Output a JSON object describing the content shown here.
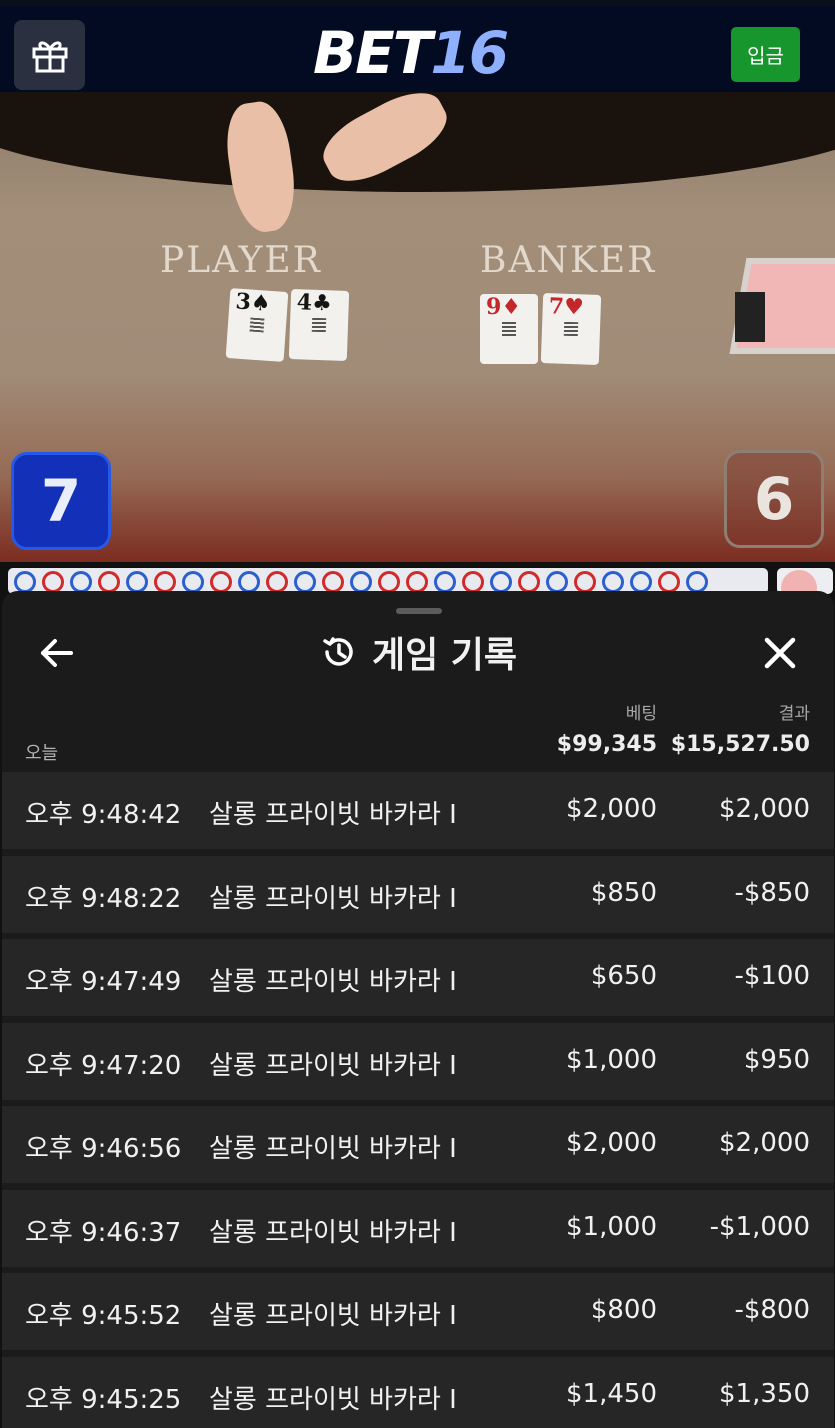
{
  "header": {
    "logo_part1": "BET",
    "logo_part2": "16",
    "deposit_label": "입금"
  },
  "game": {
    "player_label": "PLAYER",
    "banker_label": "BANKER",
    "player_cards": [
      {
        "rank": "3",
        "suit": "♠",
        "color": "black"
      },
      {
        "rank": "4",
        "suit": "♣",
        "color": "black"
      }
    ],
    "banker_cards": [
      {
        "rank": "9",
        "suit": "♦",
        "color": "red"
      },
      {
        "rank": "7",
        "suit": "♥",
        "color": "red"
      }
    ],
    "player_score": "7",
    "banker_score": "6"
  },
  "history": {
    "title": "게임 기록",
    "col_bet": "베팅",
    "col_result": "결과",
    "today_label": "오늘",
    "total_bet": "$99,345",
    "total_result": "$15,527.50",
    "rows": [
      {
        "time": "오후 9:48:42",
        "game": "살롱 프라이빗 바카라 I",
        "bet": "$2,000",
        "result": "$2,000"
      },
      {
        "time": "오후 9:48:22",
        "game": "살롱 프라이빗 바카라 I",
        "bet": "$850",
        "result": "-$850"
      },
      {
        "time": "오후 9:47:49",
        "game": "살롱 프라이빗 바카라 I",
        "bet": "$650",
        "result": "-$100"
      },
      {
        "time": "오후 9:47:20",
        "game": "살롱 프라이빗 바카라 I",
        "bet": "$1,000",
        "result": "$950"
      },
      {
        "time": "오후 9:46:56",
        "game": "살롱 프라이빗 바카라 I",
        "bet": "$2,000",
        "result": "$2,000"
      },
      {
        "time": "오후 9:46:37",
        "game": "살롱 프라이빗 바카라 I",
        "bet": "$1,000",
        "result": "-$1,000"
      },
      {
        "time": "오후 9:45:52",
        "game": "살롱 프라이빗 바카라 I",
        "bet": "$800",
        "result": "-$800"
      },
      {
        "time": "오후 9:45:25",
        "game": "살롱 프라이빗 바카라 I",
        "bet": "$1,450",
        "result": "$1,350"
      }
    ]
  },
  "icons": {
    "gift": "gift-icon",
    "history": "history-icon",
    "back": "arrow-left-icon",
    "close": "close-icon"
  },
  "colors": {
    "header_bg": "#030b22",
    "deposit_green": "#16962c",
    "player_blue": "#1230b8",
    "panel_bg": "#1b1b1b",
    "row_bg": "#262626"
  }
}
